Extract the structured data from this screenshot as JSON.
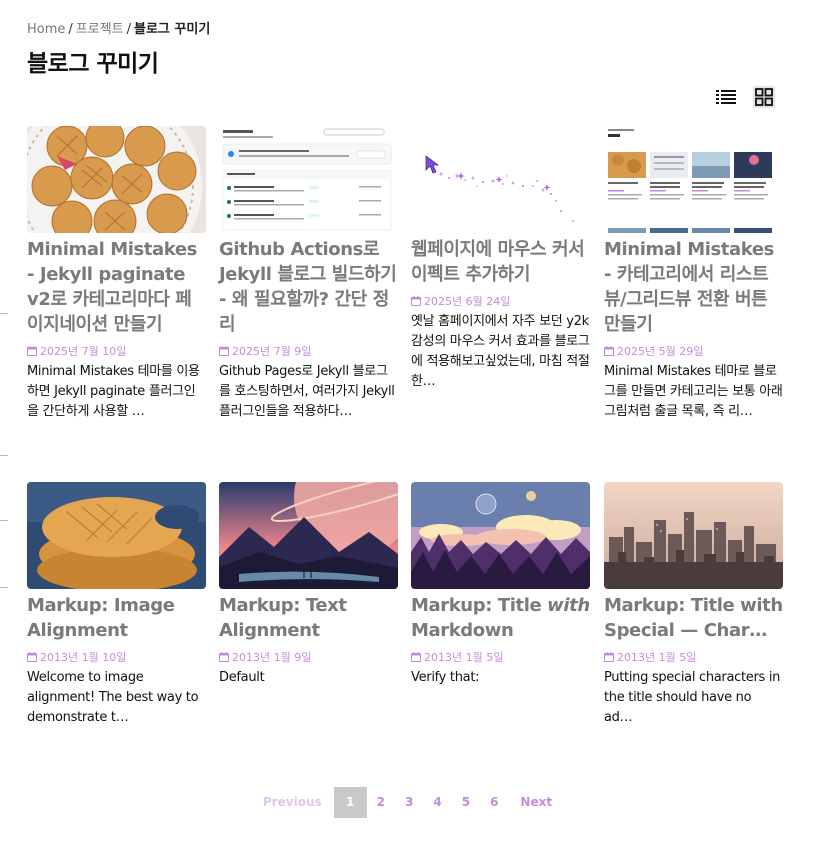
{
  "breadcrumb": {
    "home": "Home",
    "project": "프로젝트",
    "current": "블로그 꾸미기",
    "separator": "/"
  },
  "page_title": "블로그 꾸미기",
  "view_toggle": {
    "list_icon": "list-view-icon",
    "grid_icon": "grid-view-icon",
    "active": "grid"
  },
  "posts": [
    {
      "title": "Minimal Mistakes - Jekyll paginate v2로 카테고리마다 페이지네이션 만들기",
      "date": "2025년 7월 10일",
      "excerpt": "Minimal Mistakes 테마를 이용하면 Jekyll paginate 플러그인을 간단하게 사용할 …",
      "thumbnail": "cookies-on-plate"
    },
    {
      "title": "Github Actions로 Jekyll 블로그 빌드하기 - 왜 필요할까? 간단 정리",
      "date": "2025년 7월 9일",
      "excerpt": "Github Pages로 Jekyll 블로그를 호스팅하면서, 여러가지 Jekyll 플러그인들을 적용하다…",
      "thumbnail": "github-actions-screenshot"
    },
    {
      "title": "웹페이지에 마우스 커서 이펙트 추가하기",
      "date": "2025년 6월 24일",
      "excerpt": "옛날 홈페이지에서 자주 보던 y2k 감성의 마우스 커서 효과를 블로그에 적용해보고싶었는데, 마침 적절한…",
      "thumbnail": "cursor-sparkle"
    },
    {
      "title": "Minimal Mistakes - 카테고리에서 리스트뷰/그리드뷰 전환 버튼 만들기",
      "date": "2025년 5월 29일",
      "excerpt": "Minimal Mistakes 테마로 블로그를 만들면 카테고리는 보통 아래 그림처럼 출글 목록, 즉 리…",
      "thumbnail": "blog-grid-screenshot"
    },
    {
      "title_parts": [
        "Markup: Image Alignment"
      ],
      "title": "Markup: Image Alignment",
      "date": "2013년 1월 10일",
      "excerpt": "Welcome to image alignment! The best way to demonstrate t…",
      "thumbnail": "cookies-closeup"
    },
    {
      "title": "Markup: Text Alignment",
      "date": "2013년 1월 9일",
      "excerpt": "Default",
      "thumbnail": "mountain-planet-sunset"
    },
    {
      "title_pre": "Markup: Title ",
      "title_em": "with",
      "title_post": " Markdown",
      "date": "2013년 1월 5일",
      "excerpt": "Verify that:",
      "thumbnail": "pixel-forest-moon"
    },
    {
      "title": "Markup: Title with Special — Char…",
      "date": "2013년 1월 5일",
      "excerpt": "Putting special characters in the title should have no ad…",
      "thumbnail": "city-skyline"
    }
  ],
  "pagination": {
    "previous": "Previous",
    "pages": [
      "1",
      "2",
      "3",
      "4",
      "5",
      "6"
    ],
    "current": "1",
    "next": "Next"
  },
  "colors": {
    "accent": "#c38be0",
    "title_gray": "#7a7a7a",
    "current_page_bg": "#c9c9c9"
  }
}
